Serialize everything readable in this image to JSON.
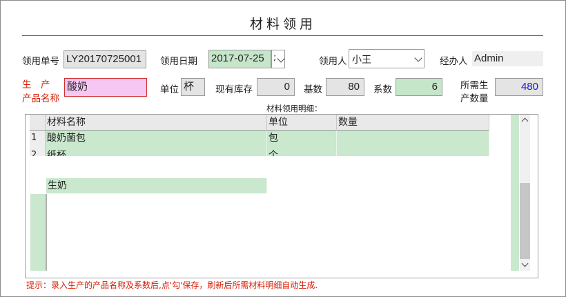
{
  "window": {
    "title": "材料领用"
  },
  "form": {
    "req_no_label": "领用单号",
    "req_no_value": "LY20170725001",
    "date_label": "领用日期",
    "date_value": "2017-07-25",
    "date_picker_glyph": ";",
    "requester_label": "领用人",
    "requester_value": "小王",
    "handler_label": "经办人",
    "handler_value": "Admin",
    "product_label_line1": "生　产",
    "product_label_line2": "产品名称",
    "product_value": "酸奶",
    "unit_label": "单位",
    "unit_value": "杯",
    "stock_label": "现有库存",
    "stock_value": "0",
    "base_label": "基数",
    "base_value": "80",
    "coef_label": "系数",
    "coef_value": "6",
    "needed_label_line1": "所需生",
    "needed_label_line2": "产数量",
    "needed_value": "480"
  },
  "detail": {
    "caption": "材料领用明细：",
    "columns": [
      "材料名称",
      "单位",
      "数量"
    ],
    "rows": [
      {
        "num": "1",
        "name": "酸奶菌包",
        "unit": "包",
        "qty": ""
      },
      {
        "num": "2",
        "name": "纸杯",
        "unit": "个",
        "qty": ""
      }
    ],
    "floating_row_name": "生奶"
  },
  "tip": "提示：录入生产的产品名称及系数后,点'勾'保存，刷新后所需材料明细自动生成.",
  "colors": {
    "accent_line": "#2e8b78",
    "label_red": "#d81e06",
    "row_green": "#c9e8cd",
    "value_blue": "#1a1ad0"
  }
}
